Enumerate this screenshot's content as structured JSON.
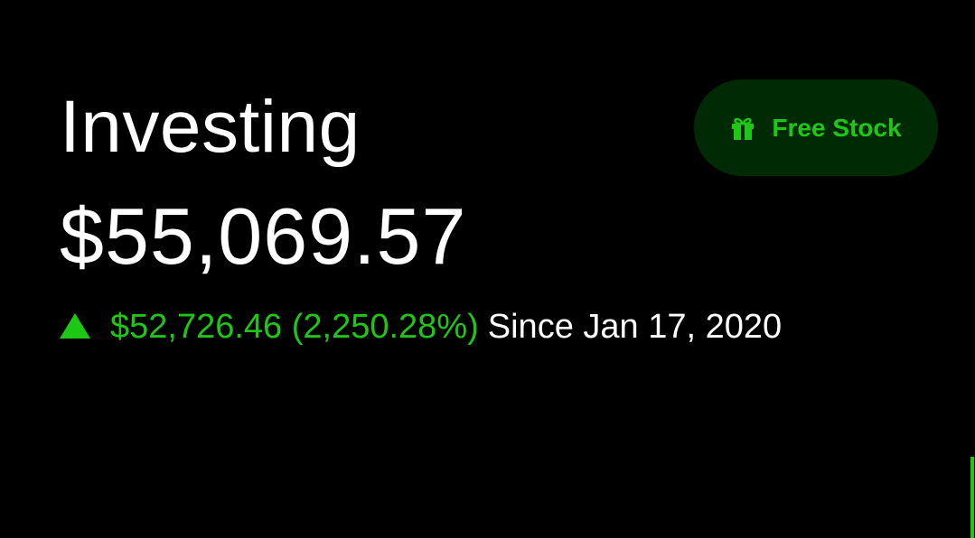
{
  "header": {
    "title": "Investing",
    "portfolio_value": "$55,069.57"
  },
  "performance": {
    "direction": "up",
    "change": "$52,726.46 (2,250.28%)",
    "since": "Since Jan 17, 2020"
  },
  "free_stock_button": {
    "label": "Free Stock",
    "icon": "gift-icon"
  },
  "colors": {
    "background": "#000000",
    "positive": "#1ec716",
    "button_background": "#002a04",
    "text": "#ffffff"
  }
}
